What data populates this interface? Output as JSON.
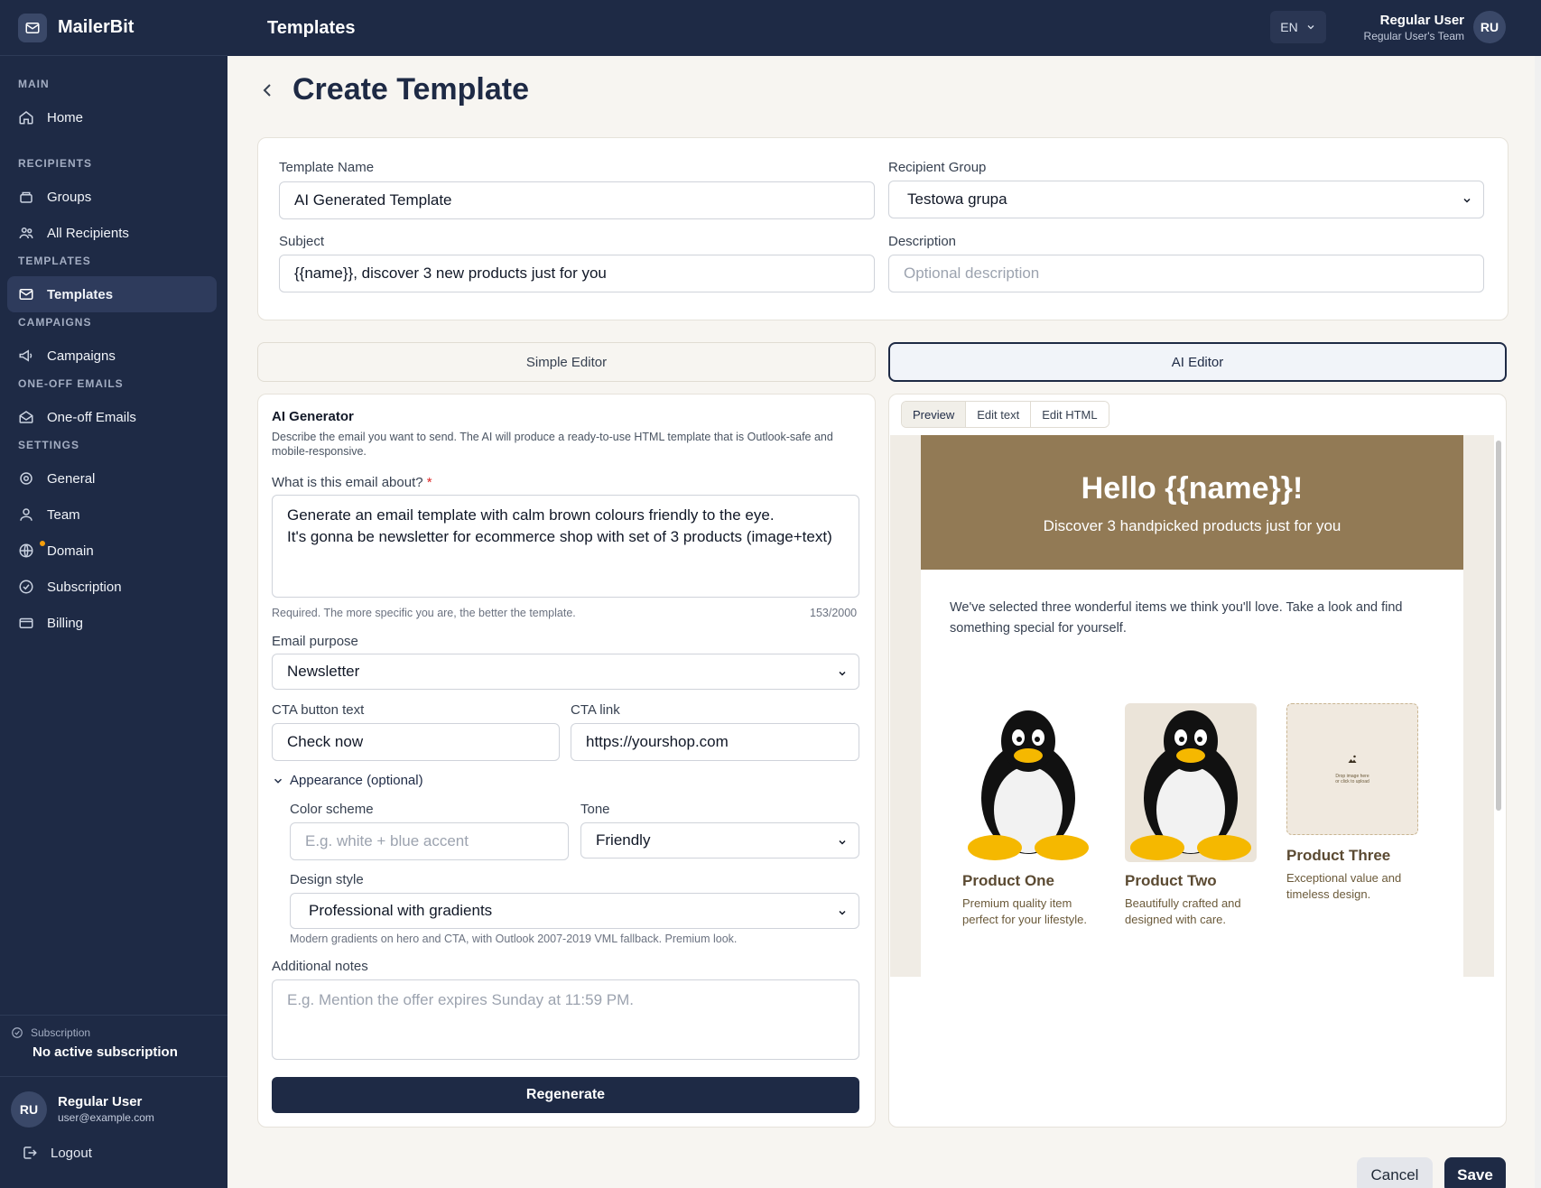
{
  "app": {
    "name": "MailerBit"
  },
  "sidebar": {
    "sections": {
      "main": "MAIN",
      "recipients": "RECIPIENTS",
      "templates": "TEMPLATES",
      "campaigns": "CAMPAIGNS",
      "oneoff": "ONE-OFF EMAILS",
      "settings": "SETTINGS"
    },
    "items": {
      "home": "Home",
      "groups": "Groups",
      "all_recipients": "All Recipients",
      "templates": "Templates",
      "campaigns": "Campaigns",
      "oneoff": "One-off Emails",
      "general": "General",
      "team": "Team",
      "domain": "Domain",
      "subscription": "Subscription",
      "billing": "Billing"
    },
    "subscription_label": "Subscription",
    "subscription_value": "No active subscription",
    "user": {
      "initials": "RU",
      "name": "Regular User",
      "email": "user@example.com"
    },
    "logout": "Logout"
  },
  "topbar": {
    "title": "Templates",
    "lang": "EN",
    "user_name": "Regular User",
    "user_team": "Regular User's Team",
    "initials": "RU"
  },
  "page": {
    "title": "Create Template"
  },
  "form": {
    "template_name_label": "Template Name",
    "template_name_value": "AI Generated Template",
    "recipient_group_label": "Recipient Group",
    "recipient_group_value": "Testowa grupa",
    "subject_label": "Subject",
    "subject_value": "{{name}}, discover 3 new products just for you",
    "description_label": "Description",
    "description_placeholder": "Optional description"
  },
  "editor_tabs": {
    "simple": "Simple Editor",
    "ai": "AI Editor"
  },
  "ai": {
    "title": "AI Generator",
    "description": "Describe the email you want to send. The AI will produce a ready-to-use HTML template that is Outlook-safe and mobile-responsive.",
    "about_label": "What is this email about?",
    "required_mark": "*",
    "about_line1": "Generate an email template with calm brown colours friendly to the eye.",
    "about_line2": "It's gonna be newsletter for ecommerce shop with set of 3 products (image+text)",
    "about_help": "Required. The more specific you are, the better the template.",
    "about_count": "153/2000",
    "purpose_label": "Email purpose",
    "purpose_value": "Newsletter",
    "cta_text_label": "CTA button text",
    "cta_text_value": "Check now",
    "cta_link_label": "CTA link",
    "cta_link_value": "https://yourshop.com",
    "appearance_label": "Appearance (optional)",
    "color_label": "Color scheme",
    "color_placeholder": "E.g. white + blue accent",
    "tone_label": "Tone",
    "tone_value": "Friendly",
    "design_label": "Design style",
    "design_value": "Professional with gradients",
    "design_help": "Modern gradients on hero and CTA, with Outlook 2007-2019 VML fallback. Premium look.",
    "notes_label": "Additional notes",
    "notes_placeholder": "E.g. Mention the offer expires Sunday at 11:59 PM.",
    "regenerate": "Regenerate"
  },
  "preview": {
    "tabs": {
      "preview": "Preview",
      "edit_text": "Edit text",
      "edit_html": "Edit HTML"
    },
    "hero_title": "Hello {{name}}!",
    "hero_subtitle": "Discover 3 handpicked products just for you",
    "intro": "We've selected three wonderful items we think you'll love. Take a look and find something special for yourself.",
    "drop_line1": "Drop image here",
    "drop_line2": "or click to upload",
    "products": [
      {
        "name": "Product One",
        "description": "Premium quality item perfect for your lifestyle."
      },
      {
        "name": "Product Two",
        "description": "Beautifully crafted and designed with care."
      },
      {
        "name": "Product Three",
        "description": "Exceptional value and timeless design."
      }
    ],
    "colors": {
      "hero": "#927a55",
      "background": "#f0ece5"
    }
  },
  "actions": {
    "cancel": "Cancel",
    "save": "Save"
  }
}
